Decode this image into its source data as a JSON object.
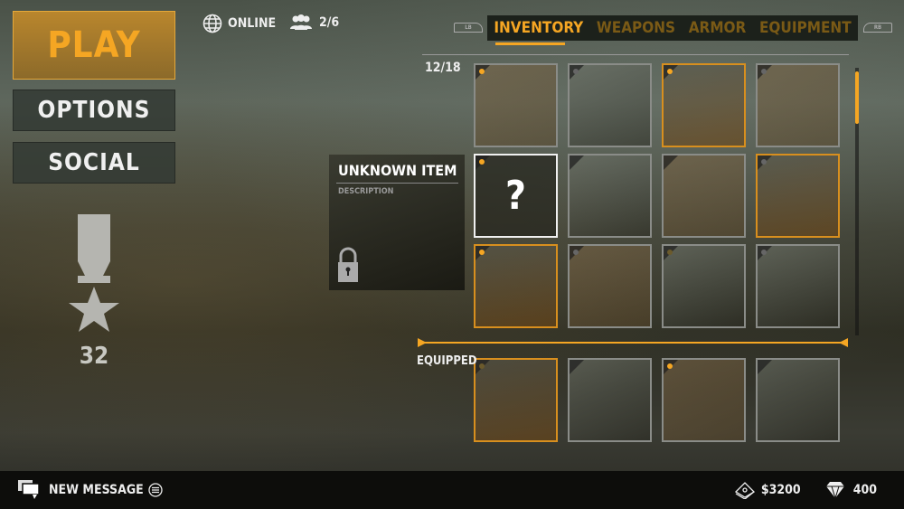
{
  "menu": {
    "play": "PLAY",
    "options": "OPTIONS",
    "social": "SOCIAL"
  },
  "status": {
    "online": "ONLINE",
    "party": "2/6"
  },
  "rank": {
    "level": "32"
  },
  "tabs": {
    "left_bumper": "LB",
    "right_bumper": "RB",
    "items": [
      {
        "label": "INVENTORY",
        "active": true
      },
      {
        "label": "WEAPONS"
      },
      {
        "label": "ARMOR"
      },
      {
        "label": "EQUIPMENT"
      }
    ]
  },
  "inventory": {
    "count": "12/18",
    "equipped_label": "EQUIPPED",
    "scroll_fraction": 0.2,
    "slots": [
      {
        "border": "grey",
        "dot": "orange"
      },
      {
        "border": "grey",
        "dot": "grey"
      },
      {
        "border": "orange",
        "dot": "orange"
      },
      {
        "border": "grey",
        "dot": "grey"
      },
      {
        "border": "white",
        "dot": "orange",
        "content": "?"
      },
      {
        "border": "grey",
        "dot": "none"
      },
      {
        "border": "grey",
        "dot": "none"
      },
      {
        "border": "orange",
        "dot": "grey"
      },
      {
        "border": "orange",
        "dot": "orange"
      },
      {
        "border": "grey",
        "dot": "grey"
      },
      {
        "border": "grey",
        "dot": "dark"
      },
      {
        "border": "grey",
        "dot": "grey"
      }
    ],
    "equipped": [
      {
        "border": "orange",
        "dot": "dark"
      },
      {
        "border": "grey",
        "dot": "none"
      },
      {
        "border": "grey",
        "dot": "orange"
      },
      {
        "border": "grey",
        "dot": "none"
      }
    ]
  },
  "item_detail": {
    "title": "UNKNOWN ITEM",
    "description": "DESCRIPTION",
    "locked": true
  },
  "footer": {
    "message": "NEW MESSAGE",
    "money": "$3200",
    "gems": "400"
  },
  "colors": {
    "accent": "#f5a623",
    "tab_inactive": "#7a5a16"
  }
}
